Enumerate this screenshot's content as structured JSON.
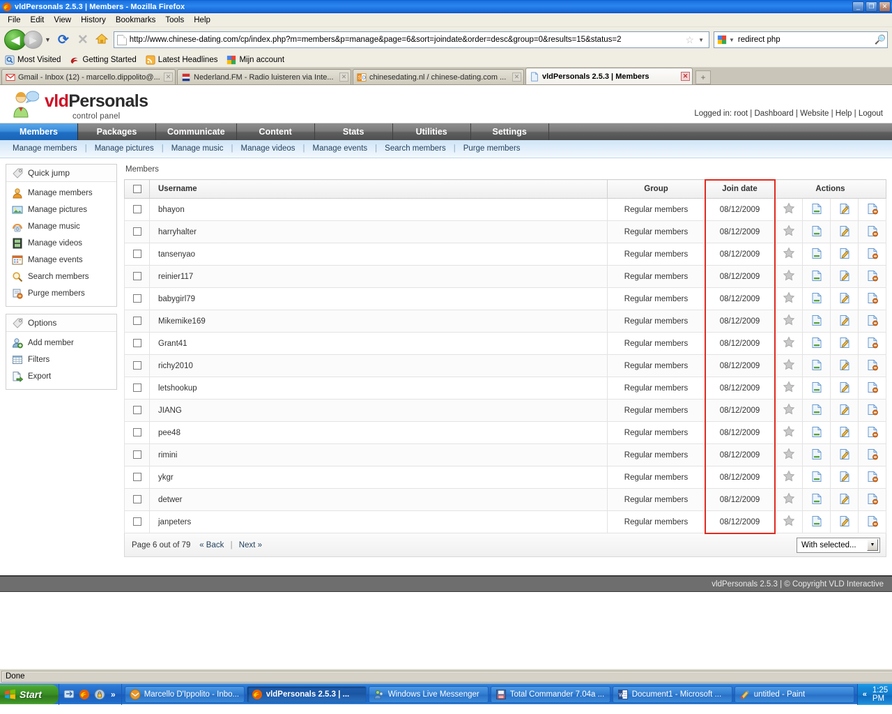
{
  "window": {
    "title": "vldPersonals 2.5.3 | Members - Mozilla Firefox",
    "minimize": "_",
    "restore": "❐",
    "close": "✕"
  },
  "menubar": {
    "items": [
      "File",
      "Edit",
      "View",
      "History",
      "Bookmarks",
      "Tools",
      "Help"
    ]
  },
  "toolbar": {
    "back_icon": "back-arrow-icon",
    "forward_icon": "forward-arrow-icon",
    "reload_glyph": "⟳",
    "stop_glyph": "✕",
    "home_icon": "home-icon",
    "url": "http://www.chinese-dating.com/cp/index.php?m=members&p=manage&page=6&sort=joindate&order=desc&group=0&results=15&status=2",
    "bookmark_star": "☆",
    "search_value": "redirect php",
    "search_engine": "google-icon",
    "search_glyph": "🔍"
  },
  "bookmarks": [
    {
      "label": "Most Visited",
      "icon": "most-visited-icon"
    },
    {
      "label": "Getting Started",
      "icon": "firefox-getting-started-icon"
    },
    {
      "label": "Latest Headlines",
      "icon": "rss-feed-icon"
    },
    {
      "label": "Mijn account",
      "icon": "google-icon"
    }
  ],
  "tabs": [
    {
      "label": "Gmail - Inbox (12) - marcello.dippolito@...",
      "icon": "gmail-icon",
      "active": false
    },
    {
      "label": "Nederland.FM - Radio luisteren via Inte...",
      "icon": "nederlandfm-icon",
      "active": false
    },
    {
      "label": "chinesedating.nl / chinese-dating.com ...",
      "icon": "chinesedating-icon",
      "active": false
    },
    {
      "label": "vldPersonals 2.5.3 | Members",
      "icon": "page-icon",
      "active": true
    }
  ],
  "newtab_glyph": "+",
  "app": {
    "logo_primary": "vld",
    "logo_secondary": "Personals",
    "logo_subtitle": "control panel",
    "account_bar": "Logged in: root | Dashboard | Website | Help | Logout",
    "nav_tabs": [
      {
        "label": "Members",
        "active": true
      },
      {
        "label": "Packages",
        "active": false
      },
      {
        "label": "Communicate",
        "active": false
      },
      {
        "label": "Content",
        "active": false
      },
      {
        "label": "Stats",
        "active": false
      },
      {
        "label": "Utilities",
        "active": false
      },
      {
        "label": "Settings",
        "active": false
      }
    ],
    "subnav": [
      "Manage members",
      "Manage pictures",
      "Manage music",
      "Manage videos",
      "Manage events",
      "Search members",
      "Purge members"
    ],
    "subnav_separator": "|",
    "footer": "vldPersonals 2.5.3 | © Copyright VLD Interactive"
  },
  "sidebar": {
    "panels": [
      {
        "title": "Quick jump",
        "head_icon": "tag-icon",
        "items": [
          {
            "label": "Manage members",
            "icon": "user-orange-icon"
          },
          {
            "label": "Manage pictures",
            "icon": "picture-icon"
          },
          {
            "label": "Manage music",
            "icon": "music-icon"
          },
          {
            "label": "Manage videos",
            "icon": "film-icon"
          },
          {
            "label": "Manage events",
            "icon": "calendar-icon"
          },
          {
            "label": "Search members",
            "icon": "magnifier-icon"
          },
          {
            "label": "Purge members",
            "icon": "purge-icon"
          }
        ]
      },
      {
        "title": "Options",
        "head_icon": "tag-icon",
        "items": [
          {
            "label": "Add member",
            "icon": "add-user-icon"
          },
          {
            "label": "Filters",
            "icon": "filter-grid-icon"
          },
          {
            "label": "Export",
            "icon": "export-icon"
          }
        ]
      }
    ]
  },
  "main": {
    "breadcrumb": "Members",
    "table": {
      "columns": [
        "",
        "Username",
        "Group",
        "Join date",
        "Actions"
      ],
      "highlight_column": "Join date",
      "highlight_color": "#e02b20",
      "action_icons": [
        "star-icon",
        "view-profile-icon",
        "edit-member-icon",
        "delete-member-icon"
      ],
      "rows": [
        {
          "username": "bhayon",
          "group": "Regular members",
          "joindate": "08/12/2009"
        },
        {
          "username": "harryhalter",
          "group": "Regular members",
          "joindate": "08/12/2009"
        },
        {
          "username": "tansenyao",
          "group": "Regular members",
          "joindate": "08/12/2009"
        },
        {
          "username": "reinier117",
          "group": "Regular members",
          "joindate": "08/12/2009"
        },
        {
          "username": "babygirl79",
          "group": "Regular members",
          "joindate": "08/12/2009"
        },
        {
          "username": "Mikemike169",
          "group": "Regular members",
          "joindate": "08/12/2009"
        },
        {
          "username": "Grant41",
          "group": "Regular members",
          "joindate": "08/12/2009"
        },
        {
          "username": "richy2010",
          "group": "Regular members",
          "joindate": "08/12/2009"
        },
        {
          "username": "letshookup",
          "group": "Regular members",
          "joindate": "08/12/2009"
        },
        {
          "username": "JIANG",
          "group": "Regular members",
          "joindate": "08/12/2009"
        },
        {
          "username": "pee48",
          "group": "Regular members",
          "joindate": "08/12/2009"
        },
        {
          "username": "rimini",
          "group": "Regular members",
          "joindate": "08/12/2009"
        },
        {
          "username": "ykgr",
          "group": "Regular members",
          "joindate": "08/12/2009"
        },
        {
          "username": "detwer",
          "group": "Regular members",
          "joindate": "08/12/2009"
        },
        {
          "username": "janpeters",
          "group": "Regular members",
          "joindate": "08/12/2009"
        }
      ]
    },
    "pagination": {
      "page_text": "Page 6 out of 79",
      "back": "« Back",
      "separator": "|",
      "next": "Next »"
    },
    "with_selected": {
      "label": "With selected...",
      "arrow": "▼"
    }
  },
  "statusbar": {
    "text": "Done"
  },
  "taskbar": {
    "start_label": "Start",
    "quicklaunch_icons": [
      "show-desktop-icon",
      "firefox-icon",
      "security-icon"
    ],
    "quicklaunch_chevron": "»",
    "tasks": [
      {
        "label": "Marcello D'Ippolito - Inbo...",
        "icon": "thunderbird-icon",
        "active": false
      },
      {
        "label": "vldPersonals 2.5.3 | ...",
        "icon": "firefox-icon",
        "active": true
      },
      {
        "label": "Windows Live Messenger",
        "icon": "messenger-icon",
        "active": false
      },
      {
        "label": "Total Commander 7.04a ...",
        "icon": "total-commander-icon",
        "active": false
      },
      {
        "label": "Document1 - Microsoft ...",
        "icon": "word-icon",
        "active": false
      },
      {
        "label": "untitled - Paint",
        "icon": "paint-icon",
        "active": false
      }
    ],
    "tray_arrow": "«",
    "clock": "1:25 PM"
  }
}
